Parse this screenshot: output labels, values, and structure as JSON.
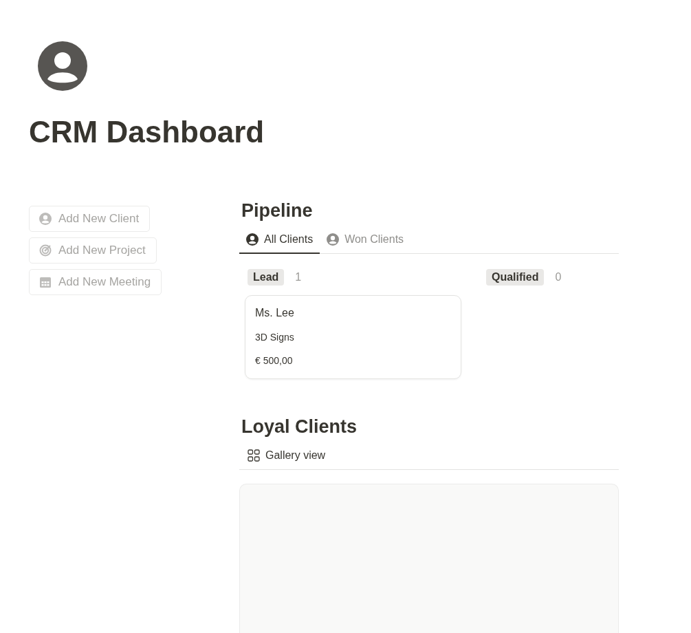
{
  "page": {
    "title": "CRM Dashboard"
  },
  "actions": [
    {
      "label": "Add New Client",
      "kind": "person"
    },
    {
      "label": "Add New Project",
      "kind": "target"
    },
    {
      "label": "Add New Meeting",
      "kind": "calendar"
    }
  ],
  "pipeline": {
    "heading": "Pipeline",
    "tabs": [
      {
        "label": "All Clients",
        "selected": true
      },
      {
        "label": "Won Clients",
        "selected": false
      }
    ],
    "columns": [
      {
        "name": "Lead",
        "count": "1",
        "cards": [
          {
            "title": "Ms. Lee",
            "project": "3D Signs",
            "amount": "€ 500,00"
          }
        ]
      },
      {
        "name": "Qualified",
        "count": "0"
      }
    ]
  },
  "loyal": {
    "heading": "Loyal Clients",
    "tabs": [
      {
        "label": "Gallery view",
        "selected": true
      }
    ]
  }
}
